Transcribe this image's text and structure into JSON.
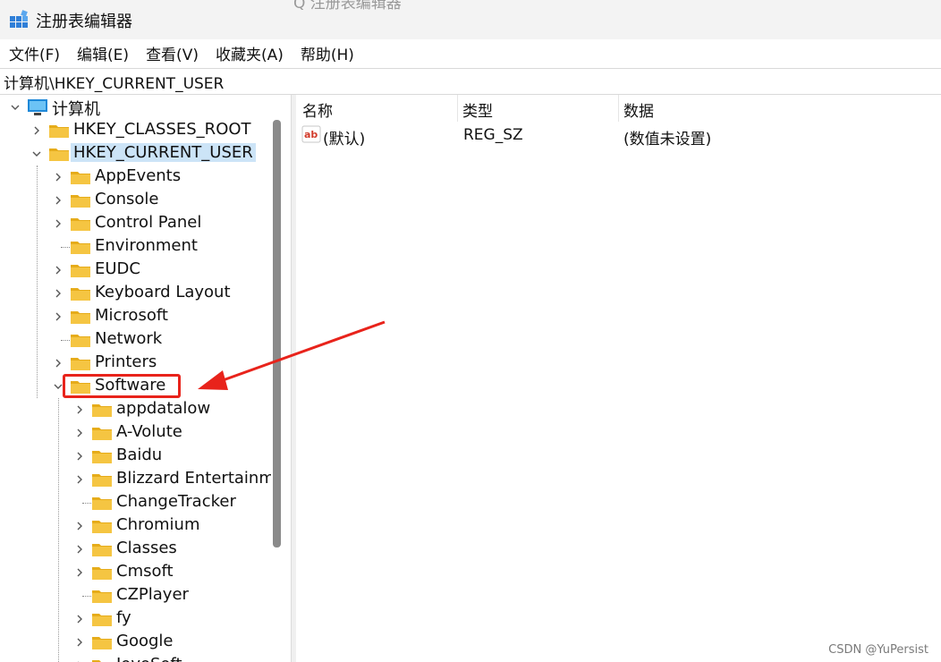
{
  "window": {
    "title": "注册表编辑器",
    "ghost_text": "Q  注册表编辑器"
  },
  "menubar": {
    "items": [
      "文件(F)",
      "编辑(E)",
      "查看(V)",
      "收藏夹(A)",
      "帮助(H)"
    ]
  },
  "address": {
    "path": "计算机\\HKEY_CURRENT_USER"
  },
  "tree": {
    "root": "计算机",
    "hives": [
      "HKEY_CLASSES_ROOT",
      "HKEY_CURRENT_USER"
    ],
    "current_user_children": [
      "AppEvents",
      "Console",
      "Control Panel",
      "Environment",
      "EUDC",
      "Keyboard Layout",
      "Microsoft",
      "Network",
      "Printers",
      "Software"
    ],
    "software_children": [
      "appdatalow",
      "A-Volute",
      "Baidu",
      "Blizzard Entertainm",
      "ChangeTracker",
      "Chromium",
      "Classes",
      "Cmsoft",
      "CZPlayer",
      "fy",
      "Google",
      "JoyoSoft"
    ]
  },
  "values_pane": {
    "headers": [
      "名称",
      "类型",
      "数据"
    ],
    "rows": [
      {
        "name": "(默认)",
        "type": "REG_SZ",
        "data": "(数值未设置)"
      }
    ]
  },
  "annotation": {
    "highlight_color": "#e8231b"
  },
  "watermark": "CSDN @YuPersist",
  "colors": {
    "selection": "#cce4f7",
    "folder": "#f5c542",
    "folder_dark": "#e6ac1a"
  }
}
